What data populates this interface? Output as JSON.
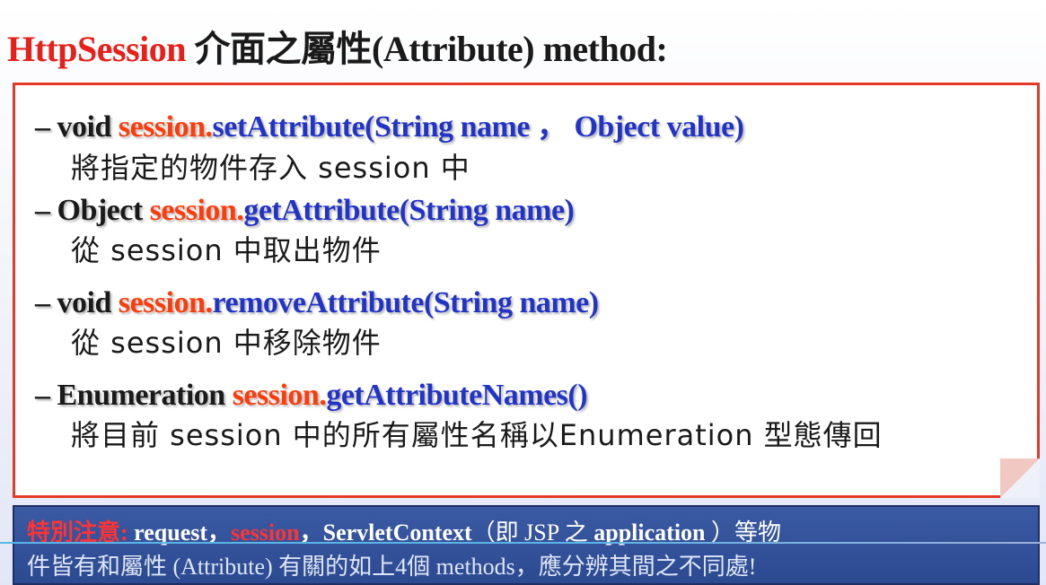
{
  "title": {
    "highlight": "HttpSession",
    "rest": " 介面之屬性(Attribute) method:"
  },
  "items": [
    {
      "ret": "– void ",
      "obj": "session.",
      "method": "setAttribute",
      "params": "(String name ， Object value)",
      "desc": "將指定的物件存入 session 中"
    },
    {
      "ret": "– Object ",
      "obj": "session.",
      "method": "getAttribute",
      "params": "(String name)",
      "desc": "從 session 中取出物件"
    },
    {
      "ret": "– void ",
      "obj": "session.",
      "method": "removeAttribute",
      "params": "(String name)",
      "desc": "從 session 中移除物件"
    },
    {
      "ret": "– Enumeration ",
      "obj": "session.",
      "method": "getAttributeNames",
      "params": "()",
      "desc": "將目前 session 中的所有屬性名稱以Enumeration 型態傳回"
    }
  ],
  "note": {
    "warn_label": "特別注意:",
    "part1": " request，",
    "session": "session",
    "part2": "，ServletContext",
    "part3": "（即 JSP 之 ",
    "application": "application",
    "part4": " ）等物",
    "line2": "件皆有和屬性 (Attribute) 有關的如上4個 methods，應分辨其間之不同處!"
  }
}
